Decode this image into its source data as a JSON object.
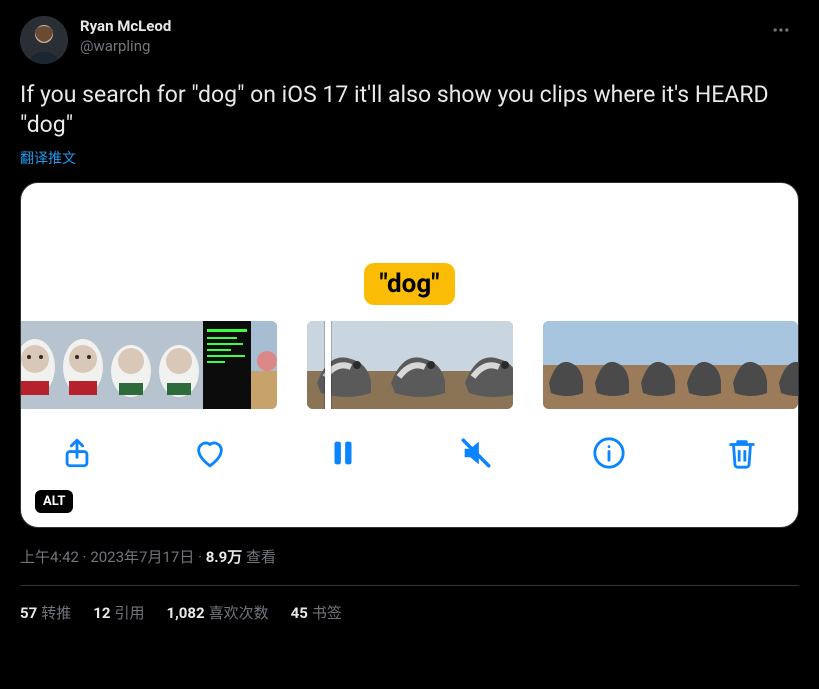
{
  "user": {
    "display_name": "Ryan McLeod",
    "handle": "@warpling"
  },
  "tweet_text": "If you search for \"dog\" on iOS 17 it'll also show you clips where it's HEARD \"dog\"",
  "translate_label": "翻译推文",
  "media": {
    "tag_text": "\"dog\"",
    "alt_badge": "ALT",
    "toolbar": {
      "share": "share-icon",
      "like": "heart-icon",
      "pause": "pause-icon",
      "mute": "mute-icon",
      "info": "info-icon",
      "trash": "trash-icon"
    }
  },
  "meta": {
    "time": "上午4:42",
    "date": "2023年7月17日",
    "views_count": "8.9万",
    "views_label": "查看"
  },
  "stats": {
    "retweets_num": "57",
    "retweets_label": "转推",
    "quotes_num": "12",
    "quotes_label": "引用",
    "likes_num": "1,082",
    "likes_label": "喜欢次数",
    "bookmarks_num": "45",
    "bookmarks_label": "书签"
  }
}
